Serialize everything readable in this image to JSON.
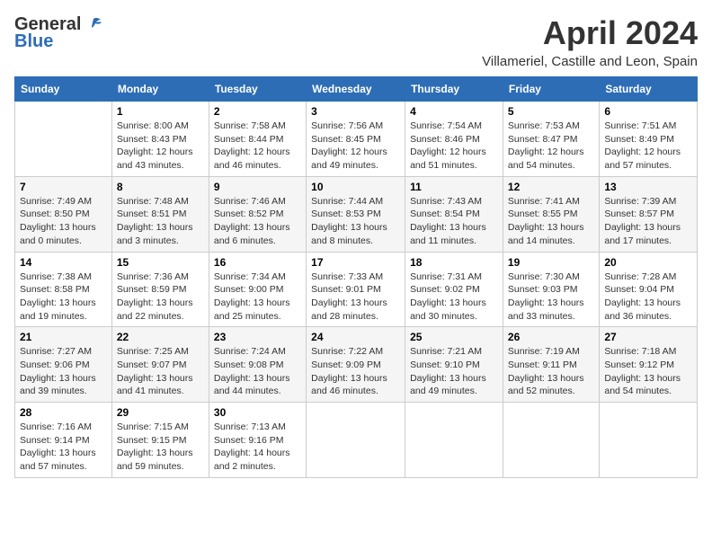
{
  "header": {
    "logo": {
      "line1": "General",
      "line2": "Blue"
    },
    "title": "April 2024",
    "location": "Villameriel, Castille and Leon, Spain"
  },
  "days_of_week": [
    "Sunday",
    "Monday",
    "Tuesday",
    "Wednesday",
    "Thursday",
    "Friday",
    "Saturday"
  ],
  "weeks": [
    [
      {
        "day": "",
        "sunrise": "",
        "sunset": "",
        "daylight": ""
      },
      {
        "day": "1",
        "sunrise": "Sunrise: 8:00 AM",
        "sunset": "Sunset: 8:43 PM",
        "daylight": "Daylight: 12 hours and 43 minutes."
      },
      {
        "day": "2",
        "sunrise": "Sunrise: 7:58 AM",
        "sunset": "Sunset: 8:44 PM",
        "daylight": "Daylight: 12 hours and 46 minutes."
      },
      {
        "day": "3",
        "sunrise": "Sunrise: 7:56 AM",
        "sunset": "Sunset: 8:45 PM",
        "daylight": "Daylight: 12 hours and 49 minutes."
      },
      {
        "day": "4",
        "sunrise": "Sunrise: 7:54 AM",
        "sunset": "Sunset: 8:46 PM",
        "daylight": "Daylight: 12 hours and 51 minutes."
      },
      {
        "day": "5",
        "sunrise": "Sunrise: 7:53 AM",
        "sunset": "Sunset: 8:47 PM",
        "daylight": "Daylight: 12 hours and 54 minutes."
      },
      {
        "day": "6",
        "sunrise": "Sunrise: 7:51 AM",
        "sunset": "Sunset: 8:49 PM",
        "daylight": "Daylight: 12 hours and 57 minutes."
      }
    ],
    [
      {
        "day": "7",
        "sunrise": "Sunrise: 7:49 AM",
        "sunset": "Sunset: 8:50 PM",
        "daylight": "Daylight: 13 hours and 0 minutes."
      },
      {
        "day": "8",
        "sunrise": "Sunrise: 7:48 AM",
        "sunset": "Sunset: 8:51 PM",
        "daylight": "Daylight: 13 hours and 3 minutes."
      },
      {
        "day": "9",
        "sunrise": "Sunrise: 7:46 AM",
        "sunset": "Sunset: 8:52 PM",
        "daylight": "Daylight: 13 hours and 6 minutes."
      },
      {
        "day": "10",
        "sunrise": "Sunrise: 7:44 AM",
        "sunset": "Sunset: 8:53 PM",
        "daylight": "Daylight: 13 hours and 8 minutes."
      },
      {
        "day": "11",
        "sunrise": "Sunrise: 7:43 AM",
        "sunset": "Sunset: 8:54 PM",
        "daylight": "Daylight: 13 hours and 11 minutes."
      },
      {
        "day": "12",
        "sunrise": "Sunrise: 7:41 AM",
        "sunset": "Sunset: 8:55 PM",
        "daylight": "Daylight: 13 hours and 14 minutes."
      },
      {
        "day": "13",
        "sunrise": "Sunrise: 7:39 AM",
        "sunset": "Sunset: 8:57 PM",
        "daylight": "Daylight: 13 hours and 17 minutes."
      }
    ],
    [
      {
        "day": "14",
        "sunrise": "Sunrise: 7:38 AM",
        "sunset": "Sunset: 8:58 PM",
        "daylight": "Daylight: 13 hours and 19 minutes."
      },
      {
        "day": "15",
        "sunrise": "Sunrise: 7:36 AM",
        "sunset": "Sunset: 8:59 PM",
        "daylight": "Daylight: 13 hours and 22 minutes."
      },
      {
        "day": "16",
        "sunrise": "Sunrise: 7:34 AM",
        "sunset": "Sunset: 9:00 PM",
        "daylight": "Daylight: 13 hours and 25 minutes."
      },
      {
        "day": "17",
        "sunrise": "Sunrise: 7:33 AM",
        "sunset": "Sunset: 9:01 PM",
        "daylight": "Daylight: 13 hours and 28 minutes."
      },
      {
        "day": "18",
        "sunrise": "Sunrise: 7:31 AM",
        "sunset": "Sunset: 9:02 PM",
        "daylight": "Daylight: 13 hours and 30 minutes."
      },
      {
        "day": "19",
        "sunrise": "Sunrise: 7:30 AM",
        "sunset": "Sunset: 9:03 PM",
        "daylight": "Daylight: 13 hours and 33 minutes."
      },
      {
        "day": "20",
        "sunrise": "Sunrise: 7:28 AM",
        "sunset": "Sunset: 9:04 PM",
        "daylight": "Daylight: 13 hours and 36 minutes."
      }
    ],
    [
      {
        "day": "21",
        "sunrise": "Sunrise: 7:27 AM",
        "sunset": "Sunset: 9:06 PM",
        "daylight": "Daylight: 13 hours and 39 minutes."
      },
      {
        "day": "22",
        "sunrise": "Sunrise: 7:25 AM",
        "sunset": "Sunset: 9:07 PM",
        "daylight": "Daylight: 13 hours and 41 minutes."
      },
      {
        "day": "23",
        "sunrise": "Sunrise: 7:24 AM",
        "sunset": "Sunset: 9:08 PM",
        "daylight": "Daylight: 13 hours and 44 minutes."
      },
      {
        "day": "24",
        "sunrise": "Sunrise: 7:22 AM",
        "sunset": "Sunset: 9:09 PM",
        "daylight": "Daylight: 13 hours and 46 minutes."
      },
      {
        "day": "25",
        "sunrise": "Sunrise: 7:21 AM",
        "sunset": "Sunset: 9:10 PM",
        "daylight": "Daylight: 13 hours and 49 minutes."
      },
      {
        "day": "26",
        "sunrise": "Sunrise: 7:19 AM",
        "sunset": "Sunset: 9:11 PM",
        "daylight": "Daylight: 13 hours and 52 minutes."
      },
      {
        "day": "27",
        "sunrise": "Sunrise: 7:18 AM",
        "sunset": "Sunset: 9:12 PM",
        "daylight": "Daylight: 13 hours and 54 minutes."
      }
    ],
    [
      {
        "day": "28",
        "sunrise": "Sunrise: 7:16 AM",
        "sunset": "Sunset: 9:14 PM",
        "daylight": "Daylight: 13 hours and 57 minutes."
      },
      {
        "day": "29",
        "sunrise": "Sunrise: 7:15 AM",
        "sunset": "Sunset: 9:15 PM",
        "daylight": "Daylight: 13 hours and 59 minutes."
      },
      {
        "day": "30",
        "sunrise": "Sunrise: 7:13 AM",
        "sunset": "Sunset: 9:16 PM",
        "daylight": "Daylight: 14 hours and 2 minutes."
      },
      {
        "day": "",
        "sunrise": "",
        "sunset": "",
        "daylight": ""
      },
      {
        "day": "",
        "sunrise": "",
        "sunset": "",
        "daylight": ""
      },
      {
        "day": "",
        "sunrise": "",
        "sunset": "",
        "daylight": ""
      },
      {
        "day": "",
        "sunrise": "",
        "sunset": "",
        "daylight": ""
      }
    ]
  ]
}
